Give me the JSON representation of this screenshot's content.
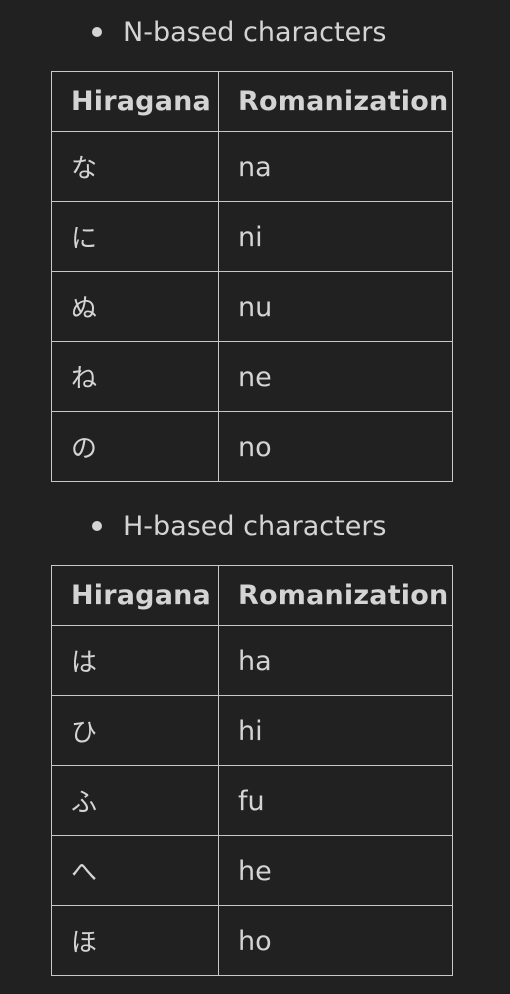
{
  "sections": [
    {
      "heading": "N-based characters",
      "header": {
        "hiragana": "Hiragana",
        "romanization": "Romanization"
      },
      "rows": [
        {
          "hiragana": "な",
          "romanization": "na"
        },
        {
          "hiragana": "に",
          "romanization": "ni"
        },
        {
          "hiragana": "ぬ",
          "romanization": "nu"
        },
        {
          "hiragana": "ね",
          "romanization": "ne"
        },
        {
          "hiragana": "の",
          "romanization": "no"
        }
      ]
    },
    {
      "heading": "H-based characters",
      "header": {
        "hiragana": "Hiragana",
        "romanization": "Romanization"
      },
      "rows": [
        {
          "hiragana": "は",
          "romanization": "ha"
        },
        {
          "hiragana": "ひ",
          "romanization": "hi"
        },
        {
          "hiragana": "ふ",
          "romanization": "fu"
        },
        {
          "hiragana": "へ",
          "romanization": "he"
        },
        {
          "hiragana": "ほ",
          "romanization": "ho"
        }
      ]
    }
  ]
}
